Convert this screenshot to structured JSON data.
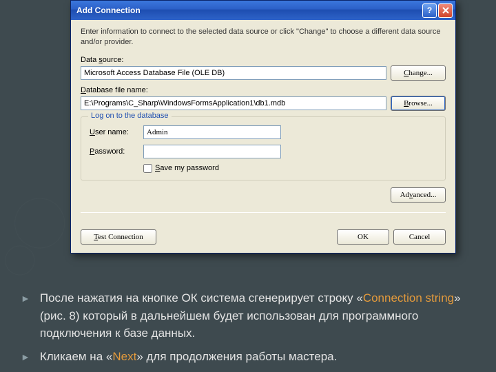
{
  "dialog": {
    "title": "Add Connection",
    "instruction": "Enter information to connect to the selected data source or click \"Change\" to choose a different data source and/or provider.",
    "data_source_label": "Data source:",
    "data_source_value": "Microsoft Access Database File (OLE DB)",
    "change_btn": "Change...",
    "db_file_label": "Database file name:",
    "db_file_value": "E:\\Programs\\C_Sharp\\WindowsFormsApplication1\\db1.mdb",
    "browse_btn": "Browse...",
    "group_title": "Log on to the database",
    "user_label": "User name:",
    "user_value": "Admin",
    "password_label": "Password:",
    "password_value": "",
    "save_pw_label": "Save my password",
    "advanced_btn": "Advanced...",
    "test_btn": "Test Connection",
    "ok_btn": "OK",
    "cancel_btn": "Cancel"
  },
  "slide": {
    "b1_pre": "После нажатия на кнопке ОК система сгенерирует строку «",
    "b1_hl": "Connection string",
    "b1_post": "» (рис. 8) который в дальнейшем будет использован для программного подключения к базе данных.",
    "b2_pre": "Кликаем на «",
    "b2_hl": "Next",
    "b2_post": "» для продолжения работы мастера."
  }
}
